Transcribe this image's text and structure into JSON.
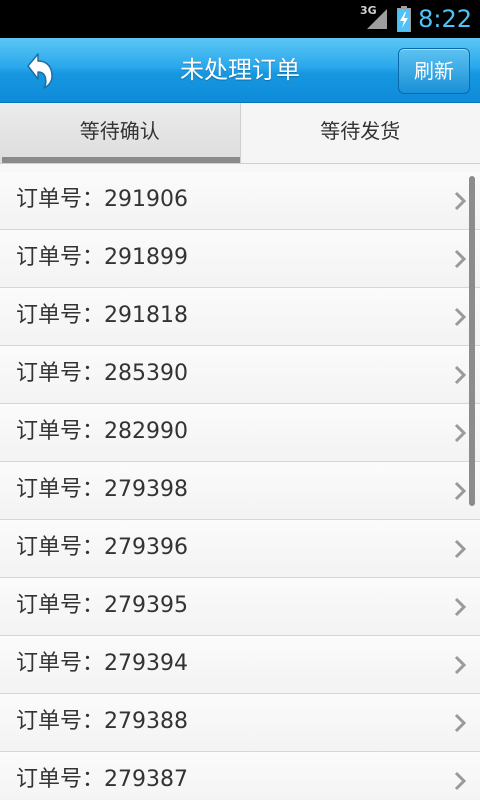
{
  "status_bar": {
    "network": "3G",
    "time": "8:22",
    "time_color": "#4fc3f7",
    "icons": [
      "signal-icon",
      "battery-icon"
    ]
  },
  "header": {
    "title": "未处理订单",
    "refresh_label": "刷新",
    "back_icon": "back-arrow-icon",
    "accent_color": "#1a9be3"
  },
  "tabs": [
    {
      "label": "等待确认",
      "active": true
    },
    {
      "label": "等待发货",
      "active": false
    }
  ],
  "orders": {
    "prefix": "订单号：",
    "items": [
      {
        "number": "291906"
      },
      {
        "number": "291899"
      },
      {
        "number": "291818"
      },
      {
        "number": "285390"
      },
      {
        "number": "282990"
      },
      {
        "number": "279398"
      },
      {
        "number": "279396"
      },
      {
        "number": "279395"
      },
      {
        "number": "279394"
      },
      {
        "number": "279388"
      },
      {
        "number": "279387"
      }
    ],
    "row_icon": "chevron-right-icon"
  }
}
